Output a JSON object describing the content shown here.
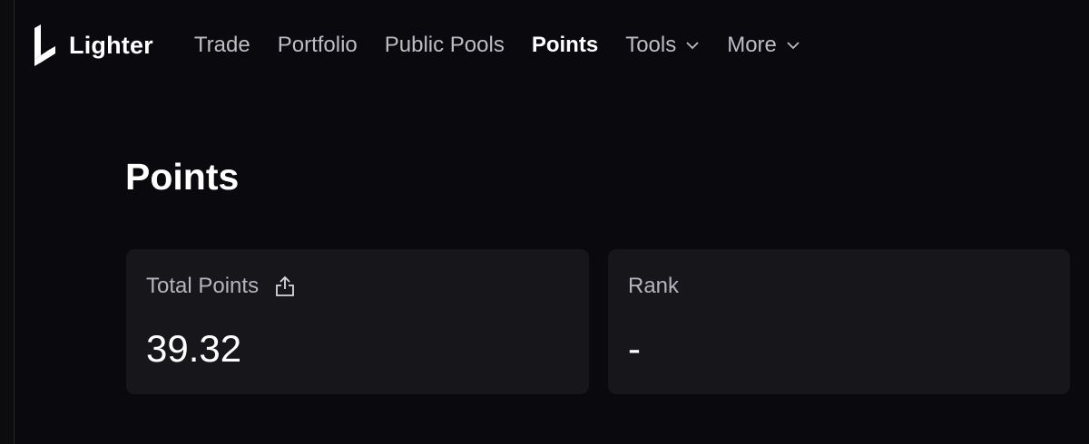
{
  "brand": {
    "name": "Lighter",
    "logo_icon": "lighter-logo-icon"
  },
  "nav": {
    "items": [
      {
        "label": "Trade",
        "active": false,
        "has_dropdown": false
      },
      {
        "label": "Portfolio",
        "active": false,
        "has_dropdown": false
      },
      {
        "label": "Public Pools",
        "active": false,
        "has_dropdown": false
      },
      {
        "label": "Points",
        "active": true,
        "has_dropdown": false
      },
      {
        "label": "Tools",
        "active": false,
        "has_dropdown": true
      },
      {
        "label": "More",
        "active": false,
        "has_dropdown": true
      }
    ]
  },
  "page": {
    "title": "Points"
  },
  "cards": {
    "total_points": {
      "label": "Total Points",
      "value": "39.32",
      "icon": "share-icon"
    },
    "rank": {
      "label": "Rank",
      "value": "-"
    }
  },
  "colors": {
    "background": "#0a090e",
    "card": "#17171b",
    "nav_text": "#bdbdc4",
    "nav_active": "#ffffff",
    "label_text": "#b4b4bb"
  }
}
